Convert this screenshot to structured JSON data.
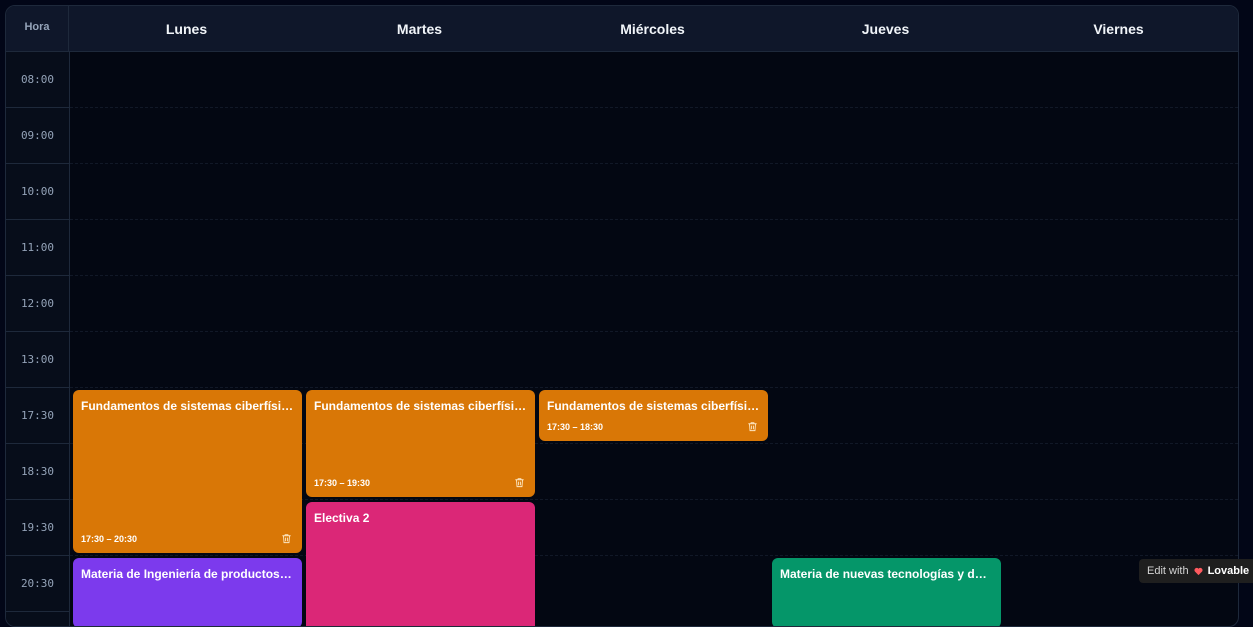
{
  "header": {
    "hora_label": "Hora",
    "days": [
      "Lunes",
      "Martes",
      "Miércoles",
      "Jueves",
      "Viernes"
    ]
  },
  "times": [
    "08:00",
    "09:00",
    "10:00",
    "11:00",
    "12:00",
    "13:00",
    "17:30",
    "18:30",
    "19:30",
    "20:30"
  ],
  "events": [
    {
      "title": "Fundamentos de sistemas ciberfísicos",
      "time": "17:30 – 20:30",
      "color": "#d97706"
    },
    {
      "title": "Fundamentos de sistemas ciberfísicos",
      "time": "17:30 – 19:30",
      "color": "#d97706"
    },
    {
      "title": "Fundamentos de sistemas ciberfísicos",
      "time": "17:30 – 18:30",
      "color": "#d97706"
    },
    {
      "title": "Electiva 2",
      "time": "",
      "color": "#db2777"
    },
    {
      "title": "Materia de Ingeniería de productos d...",
      "time": "",
      "color": "#7c3aed"
    },
    {
      "title": "Materia de nuevas tecnologías y dom...",
      "time": "",
      "color": "#059669"
    }
  ],
  "badge": {
    "edit_with": "Edit with",
    "brand": "Lovable"
  }
}
